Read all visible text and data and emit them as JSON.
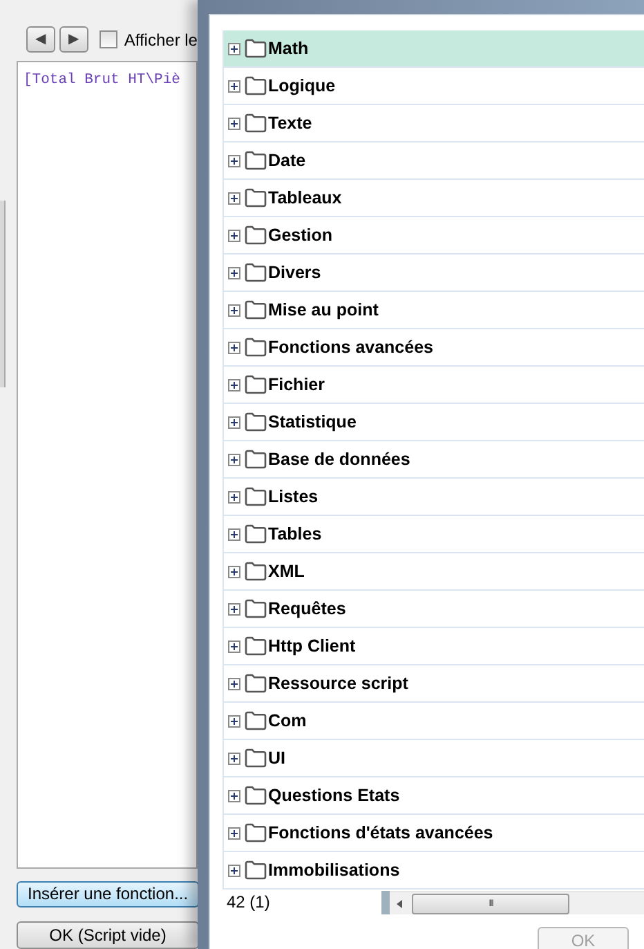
{
  "editor": {
    "nav_back": "◀",
    "nav_forward": "▶",
    "show_checkbox": {
      "label": "Afficher le",
      "checked": false
    },
    "code": "[Total Brut HT\\Piè",
    "insert_button": "Insérer une fonction...",
    "ok_button": "OK (Script vide)"
  },
  "dialog": {
    "items": [
      {
        "label": "Math",
        "selected": true
      },
      {
        "label": "Logique",
        "selected": false
      },
      {
        "label": "Texte",
        "selected": false
      },
      {
        "label": "Date",
        "selected": false
      },
      {
        "label": "Tableaux",
        "selected": false
      },
      {
        "label": "Gestion",
        "selected": false
      },
      {
        "label": "Divers",
        "selected": false
      },
      {
        "label": "Mise au point",
        "selected": false
      },
      {
        "label": "Fonctions avancées",
        "selected": false
      },
      {
        "label": "Fichier",
        "selected": false
      },
      {
        "label": "Statistique",
        "selected": false
      },
      {
        "label": "Base de données",
        "selected": false
      },
      {
        "label": "Listes",
        "selected": false
      },
      {
        "label": "Tables",
        "selected": false
      },
      {
        "label": "XML",
        "selected": false
      },
      {
        "label": "Requêtes",
        "selected": false
      },
      {
        "label": "Http Client",
        "selected": false
      },
      {
        "label": "Ressource script",
        "selected": false
      },
      {
        "label": "Com",
        "selected": false
      },
      {
        "label": "UI",
        "selected": false
      },
      {
        "label": "Questions Etats",
        "selected": false
      },
      {
        "label": "Fonctions d'états avancées",
        "selected": false
      },
      {
        "label": "Immobilisations",
        "selected": false
      }
    ],
    "status_count": "42 (1)",
    "scroll_grip": "III",
    "ok_button": "OK"
  }
}
